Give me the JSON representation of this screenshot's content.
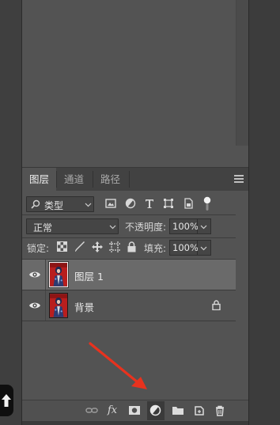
{
  "layers_panel": {
    "tabs": [
      {
        "label": "图层",
        "active": true
      },
      {
        "label": "通道",
        "active": false
      },
      {
        "label": "路径",
        "active": false
      }
    ],
    "filter": {
      "kind_label": "类型",
      "icons": [
        "image-filter-icon",
        "adjustment-filter-icon",
        "type-filter-icon",
        "shape-filter-icon",
        "smart-object-filter-icon"
      ]
    },
    "blend_mode": "正常",
    "opacity_label": "不透明度:",
    "opacity_value": "100%",
    "lock_label": "锁定:",
    "fill_label": "填充:",
    "fill_value": "100%",
    "layers": [
      {
        "name": "图层 1",
        "visible": true,
        "selected": true,
        "locked": false
      },
      {
        "name": "背景",
        "visible": true,
        "selected": false,
        "locked": true
      }
    ],
    "bottom_tools": [
      "link-layers-icon",
      "fx-icon",
      "add-mask-icon",
      "adjustment-layer-icon",
      "new-group-icon",
      "new-layer-icon",
      "delete-icon"
    ],
    "bottom_fx_label": "fx"
  },
  "colors": {
    "panel_bg": "#535353",
    "selected_row": "#6a6a6a",
    "annotation_arrow": "#e8321e"
  }
}
